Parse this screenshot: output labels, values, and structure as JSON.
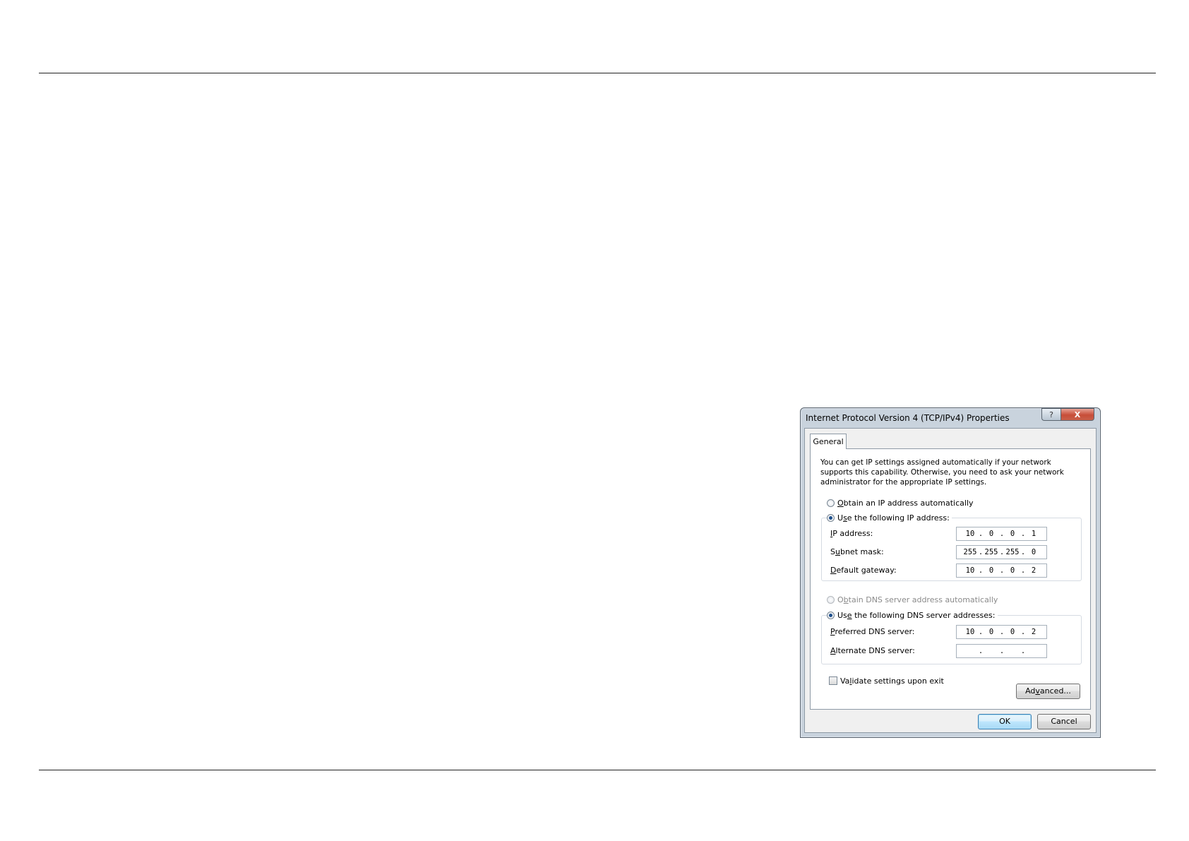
{
  "dialog": {
    "title": "Internet Protocol Version 4 (TCP/IPv4) Properties",
    "help_button": "?",
    "close_button": "X",
    "tab": "General",
    "description": "You can get IP settings assigned automatically if your network supports this capability. Otherwise, you need to ask your network administrator for the appropriate IP settings.",
    "ip_auto": {
      "mnemonic": "O",
      "rest": "btain an IP address automatically",
      "selected": false
    },
    "ip_manual": {
      "pre": "U",
      "mnemonic": "s",
      "rest": "e the following IP address:",
      "selected": true
    },
    "ip_fields": [
      {
        "mnemonic": "I",
        "rest": "P address:",
        "octets": [
          "10",
          "0",
          "0",
          "1"
        ]
      },
      {
        "pre": "S",
        "mnemonic": "u",
        "rest": "bnet mask:",
        "octets": [
          "255",
          "255",
          "255",
          "0"
        ]
      },
      {
        "mnemonic": "D",
        "rest": "efault gateway:",
        "octets": [
          "10",
          "0",
          "0",
          "2"
        ]
      }
    ],
    "dns_auto": {
      "pre": "O",
      "mnemonic": "b",
      "rest": "tain DNS server address automatically",
      "selected": false,
      "disabled": true
    },
    "dns_manual": {
      "pre": "Us",
      "mnemonic": "e",
      "rest": " the following DNS server addresses:",
      "selected": true
    },
    "dns_fields": [
      {
        "mnemonic": "P",
        "rest": "referred DNS server:",
        "octets": [
          "10",
          "0",
          "0",
          "2"
        ]
      },
      {
        "mnemonic": "A",
        "rest": "lternate DNS server:",
        "octets": [
          "",
          "",
          "",
          ""
        ]
      }
    ],
    "validate": {
      "pre": "Va",
      "mnemonic": "l",
      "rest": "idate settings upon exit",
      "checked": false
    },
    "advanced_button": {
      "pre": "Ad",
      "mnemonic": "v",
      "rest": "anced..."
    },
    "ok_button": "OK",
    "cancel_button": "Cancel"
  }
}
